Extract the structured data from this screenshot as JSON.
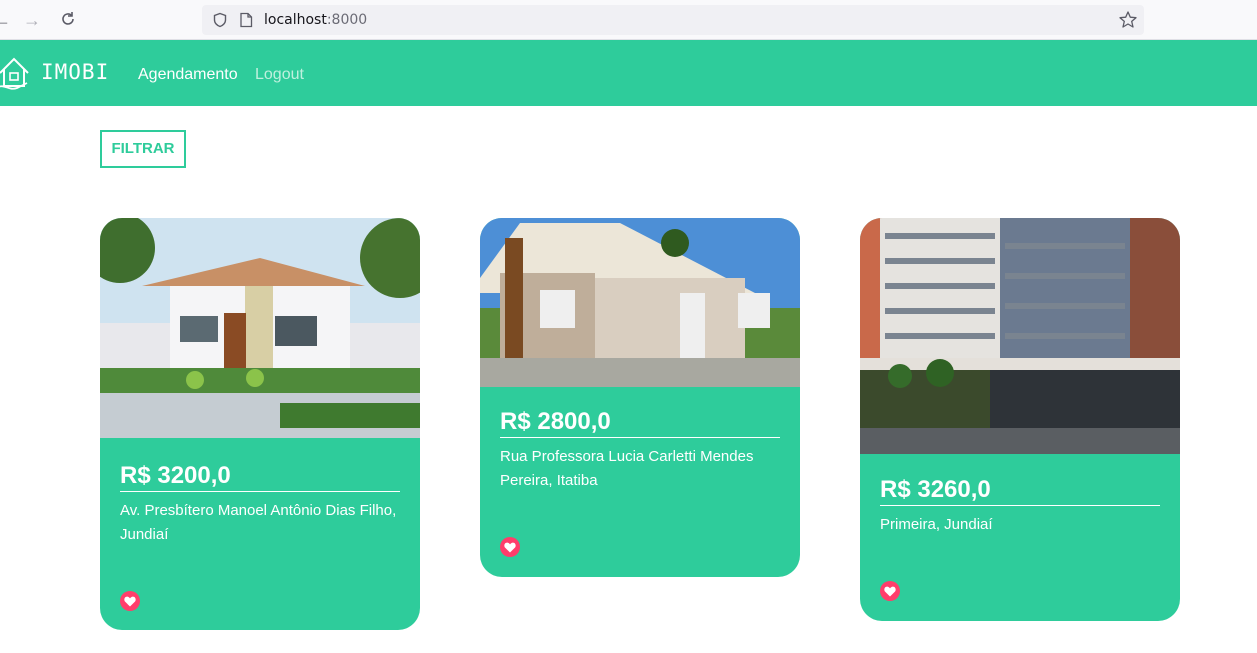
{
  "browser": {
    "url_host": "localhost",
    "url_port": ":8000"
  },
  "header": {
    "logo_text": "IMOBI",
    "nav": [
      {
        "label": "Agendamento"
      },
      {
        "label": "Logout"
      }
    ]
  },
  "filter": {
    "label": "FILTRAR"
  },
  "properties": [
    {
      "price": "R$ 3200,0",
      "address": "Av. Presbítero Manoel Antônio Dias Filho, Jundiaí"
    },
    {
      "price": "R$ 2800,0",
      "address": "Rua Professora Lucia Carletti Mendes Pereira, Itatiba"
    },
    {
      "price": "R$ 3260,0",
      "address": "Primeira, Jundiaí"
    }
  ],
  "colors": {
    "brand": "#2ecc9b",
    "heart": "#ff3d6b"
  },
  "icons": {
    "logo": "house-logo-icon",
    "favorite": "heart-icon"
  }
}
